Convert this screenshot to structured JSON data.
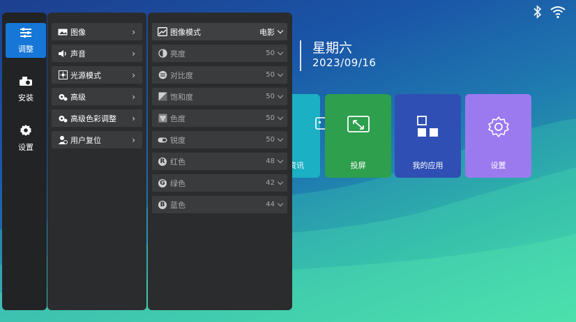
{
  "status": {
    "bluetooth_icon": "bluetooth-icon",
    "wifi_icon": "wifi-icon"
  },
  "home": {
    "weekday": "星期六",
    "date": "2023/09/16"
  },
  "tiles": [
    {
      "label": "资讯",
      "icon": "news-icon",
      "color": "#1bb0c4"
    },
    {
      "label": "投屏",
      "icon": "cast-icon",
      "color": "#2e9f4d"
    },
    {
      "label": "我的应用",
      "icon": "apps-icon",
      "color": "#2f4fb5"
    },
    {
      "label": "设置",
      "icon": "gear-icon",
      "color": "#9b7af0"
    }
  ],
  "sidebar": {
    "items": [
      {
        "label": "调整",
        "icon": "sliders-icon",
        "active": true
      },
      {
        "label": "安装",
        "icon": "projector-icon",
        "active": false
      },
      {
        "label": "设置",
        "icon": "gear-icon",
        "active": false
      }
    ]
  },
  "menu": {
    "items": [
      {
        "label": "图像",
        "icon": "image-icon"
      },
      {
        "label": "声音",
        "icon": "speaker-icon"
      },
      {
        "label": "光源模式",
        "icon": "light-source-icon"
      },
      {
        "label": "高级",
        "icon": "gears-icon"
      },
      {
        "label": "高级色彩调整",
        "icon": "color-gears-icon"
      },
      {
        "label": "用户复位",
        "icon": "user-reset-icon"
      }
    ]
  },
  "settings": {
    "items": [
      {
        "label": "图像模式",
        "value": "电影",
        "icon": "picture-mode-icon"
      },
      {
        "label": "亮度",
        "value": "50",
        "icon": "brightness-icon"
      },
      {
        "label": "对比度",
        "value": "50",
        "icon": "contrast-icon"
      },
      {
        "label": "饱和度",
        "value": "50",
        "icon": "saturation-icon"
      },
      {
        "label": "色度",
        "value": "50",
        "icon": "hue-icon"
      },
      {
        "label": "锐度",
        "value": "50",
        "icon": "sharpness-icon"
      },
      {
        "label": "红色",
        "value": "48",
        "icon": "red-icon",
        "letter": "R"
      },
      {
        "label": "绿色",
        "value": "42",
        "icon": "green-icon",
        "letter": "G"
      },
      {
        "label": "蓝色",
        "value": "44",
        "icon": "blue-icon",
        "letter": "B"
      }
    ]
  },
  "colors": {
    "accent": "#1677d8",
    "panel": "#2b2c2e",
    "item": "#3a3b3d"
  }
}
